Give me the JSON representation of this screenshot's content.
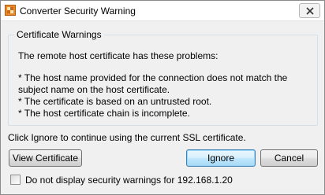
{
  "window": {
    "title": "Converter Security Warning",
    "icon": "converter-app-icon",
    "close_icon": "close-icon"
  },
  "group": {
    "legend": "Certificate Warnings",
    "intro": "The remote host certificate has these problems:",
    "problems": [
      " * The host name provided for the connection does not match the",
      "subject name on the host certificate.",
      " * The certificate is based on an untrusted root.",
      " * The host certificate chain is incomplete."
    ]
  },
  "instruction": "Click Ignore to continue using the current SSL certificate.",
  "buttons": {
    "view_certificate": "View Certificate",
    "ignore": "Ignore",
    "cancel": "Cancel"
  },
  "checkbox": {
    "label": "Do not display security warnings for 192.168.1.20",
    "checked": false
  },
  "colors": {
    "accent": "#3c7fb1",
    "icon_orange": "#e8892a"
  }
}
